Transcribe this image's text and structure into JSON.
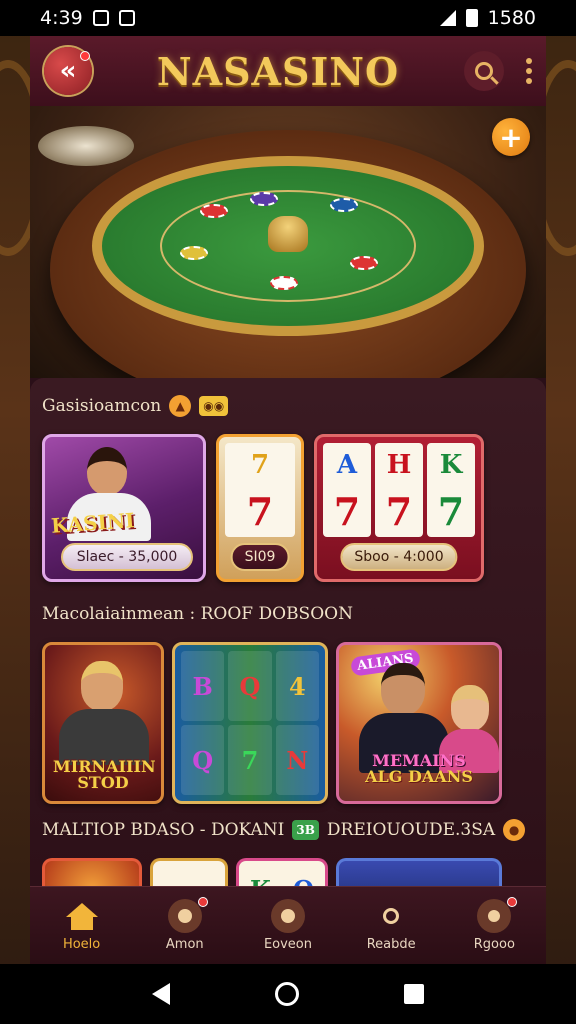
{
  "status_bar": {
    "time": "4:39",
    "battery": "1580"
  },
  "header": {
    "title": "NASASINO",
    "back_icon": "back-arrow-icon",
    "search_icon": "search-icon",
    "more_icon": "more-vertical-icon"
  },
  "hero": {
    "add_icon": "plus-icon"
  },
  "section1": {
    "title": "Gasisioamcon",
    "cards": [
      {
        "label": "KASINI",
        "price": "Slaec - 35,000"
      },
      {
        "reel_symbols": [
          "7",
          "7"
        ],
        "price": "SI09"
      },
      {
        "reel_symbols": [
          "A",
          "7",
          "H",
          "7",
          "K",
          "7"
        ],
        "price": "Sboo - 4:000"
      }
    ]
  },
  "section2": {
    "title": "Macolaiainmean : ROOF DOBSOON",
    "cards": [
      {
        "line1": "MIRNAIIIN",
        "line2": "STOD"
      },
      {
        "symbols": [
          "B",
          "Q",
          "4",
          "Q",
          "7",
          "N"
        ]
      },
      {
        "tag": "ALIANS",
        "line1": "MEMAINS",
        "line2": "ALG DAANS"
      }
    ]
  },
  "section3": {
    "title": "MALTIOP BDASO - DOKANI",
    "badge": "3B",
    "title2": "DREIOUOUDE.3SA",
    "peek_symbols": [
      "K",
      "Q"
    ]
  },
  "bottom_nav": {
    "items": [
      {
        "label": "Hoelo",
        "icon": "home-icon"
      },
      {
        "label": "Amon",
        "icon": "chat-icon"
      },
      {
        "label": "Eoveon",
        "icon": "wallet-icon"
      },
      {
        "label": "Reabde",
        "icon": "search-icon"
      },
      {
        "label": "Rgooo",
        "icon": "profile-icon"
      }
    ]
  },
  "colors": {
    "accent_gold": "#f3c95b",
    "panel_bg": "#2a0f18",
    "nav_active": "#f2b53a"
  }
}
